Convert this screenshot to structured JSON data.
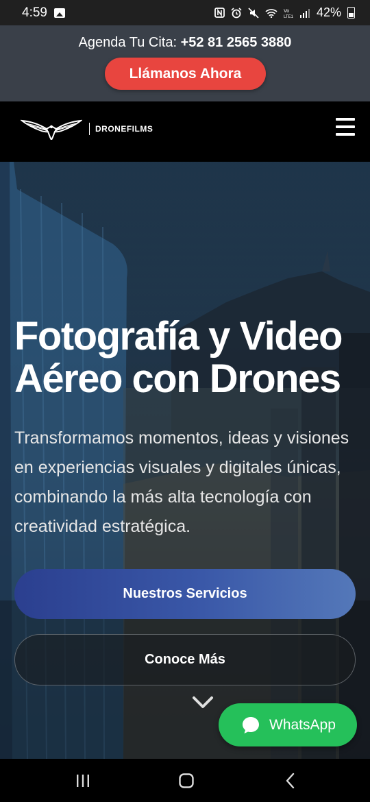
{
  "status_bar": {
    "time": "4:59",
    "battery": "42%",
    "icons": [
      "gallery-icon",
      "nfc-icon",
      "alarm-icon",
      "mute-icon",
      "wifi-icon",
      "volte-icon",
      "signal-icon",
      "battery-icon"
    ]
  },
  "promo": {
    "label": "Agenda Tu Cita:",
    "phone": "+52 81 2565 3880",
    "call_button": "Llámanos Ahora",
    "call_color": "#e8453f"
  },
  "header": {
    "logo_text": "DRONEFILMS",
    "menu_icon": "hamburger-icon"
  },
  "hero": {
    "title_line1": "Fotografía y Video",
    "title_line2": "Aéreo con Drones",
    "description": "Transformamos momentos, ideas y visiones en experiencias visuales y digitales únicas, combinando la más alta tecnología con creatividad estratégica.",
    "primary_cta": "Nuestros Servicios",
    "secondary_cta": "Conoce Más",
    "scroll_icon": "chevron-down-icon"
  },
  "whatsapp": {
    "label": "WhatsApp",
    "color": "#25c05a"
  },
  "nav_bar": {
    "icons": [
      "recent-apps-icon",
      "home-icon",
      "back-icon"
    ]
  }
}
